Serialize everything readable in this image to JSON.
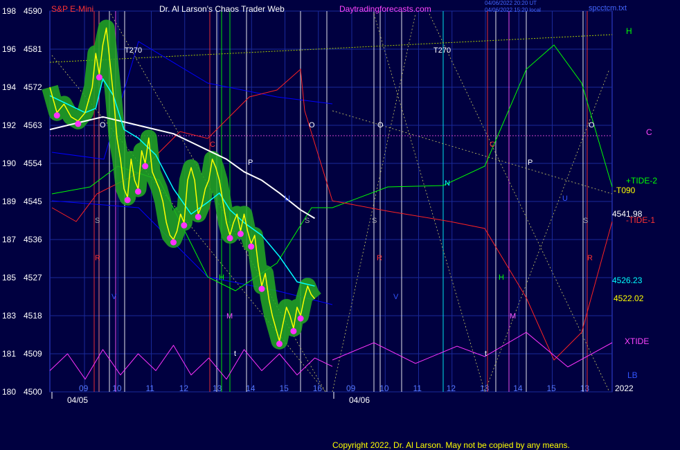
{
  "header": {
    "instrument": "S&P E-Mini",
    "title": "Dr. Al Larson's Chaos Trader Web",
    "site": "Daytradingforecasts.com",
    "stamp1": "04/06/2022 20:20 UT",
    "stamp2": "04/06/2022 15:20 local",
    "stamp3": "spcctcm.txt"
  },
  "copyright": "Copyright 2022, Dr. Al Larson. May not be copied by any means.",
  "colors": {
    "background": "#000040",
    "grid": "#1a2a9a",
    "price": "#ffff00",
    "avg_fast": "#00ffff",
    "avg_slow": "#ffffff",
    "band": "#22aa22",
    "xtide": "#ff33ff",
    "tide1": "#ff2222",
    "tide2": "#00ff00",
    "electric_field": "#0000ff"
  },
  "chart_data": {
    "type": "line",
    "title": "",
    "y_left_labels": [
      "198",
      "196",
      "194",
      "192",
      "190",
      "189",
      "187",
      "185",
      "183",
      "181",
      "180"
    ],
    "y_right_labels": [
      "4590",
      "4581",
      "4572",
      "4563",
      "4554",
      "4545",
      "4536",
      "4527",
      "4518",
      "4509",
      "4500"
    ],
    "y_range": [
      4500,
      4590
    ],
    "x_range_hours": [
      8.5,
      16.5
    ],
    "x_hour_labels": [
      "09",
      "10",
      "11",
      "12",
      "13",
      "14",
      "15",
      "16",
      "09",
      "10",
      "11",
      "12",
      "13",
      "14",
      "15",
      "13"
    ],
    "x_date_labels": [
      "04/05",
      "04/06"
    ],
    "year_label": "2022",
    "right_side_labels": {
      "h": "H",
      "c": "C",
      "tide2": "+TIDE-2",
      "t090": "-T090",
      "price_last": "4541.98",
      "tide1": "-TIDE-1",
      "avg_last": "4526.23",
      "close_last": "4522.02",
      "xtide": "XTIDE",
      "lb": "LB"
    },
    "annotations": [
      "T270",
      "T270",
      "O",
      "O",
      "O",
      "O",
      "P",
      "P",
      "C",
      "C",
      "S",
      "S",
      "S",
      "S",
      "R",
      "R",
      "R",
      "H",
      "H",
      "M",
      "M",
      "N",
      "U",
      "U",
      "V",
      "V",
      "t",
      "t"
    ],
    "price_series": {
      "name": "",
      "x": [
        8.5,
        8.7,
        8.9,
        9.1,
        9.3,
        9.5,
        9.7,
        9.8,
        9.9,
        10.0,
        10.1,
        10.2,
        10.3,
        10.4,
        10.5,
        10.6,
        10.7,
        10.8,
        10.9,
        11.0,
        11.1,
        11.2,
        11.3,
        11.4,
        11.5,
        11.6,
        11.7,
        11.8,
        11.9,
        12.0,
        12.1,
        12.2,
        12.3,
        12.4,
        12.5,
        12.6,
        12.7,
        12.8,
        12.9,
        13.0,
        13.1,
        13.2,
        13.3,
        13.4,
        13.5,
        13.6,
        13.7,
        13.8,
        13.9,
        14.0,
        14.1,
        14.2,
        14.3,
        14.4,
        14.5,
        14.6,
        14.7,
        14.8,
        14.9,
        15.0,
        15.1,
        15.2,
        15.3,
        15.4,
        15.5,
        15.6,
        15.7,
        15.8,
        15.9,
        16.0
      ],
      "y": [
        4572,
        4566,
        4568,
        4565,
        4564,
        4566,
        4572,
        4580,
        4575,
        4582,
        4586,
        4578,
        4570,
        4560,
        4555,
        4548,
        4546,
        4555,
        4550,
        4548,
        4557,
        4554,
        4560,
        4552,
        4550,
        4548,
        4545,
        4540,
        4537,
        4536,
        4538,
        4542,
        4540,
        4550,
        4553,
        4550,
        4542,
        4544,
        4548,
        4550,
        4555,
        4553,
        4550,
        4545,
        4540,
        4537,
        4540,
        4542,
        4538,
        4542,
        4538,
        4535,
        4537,
        4530,
        4525,
        4528,
        4522,
        4518,
        4515,
        4512,
        4516,
        4520,
        4518,
        4515,
        4520,
        4518,
        4522,
        4525,
        4523,
        4522
      ]
    },
    "avg_fast": {
      "name": "",
      "x": [
        8.5,
        9.0,
        9.5,
        9.8,
        10.0,
        10.3,
        10.6,
        11.0,
        11.5,
        12.0,
        12.5,
        13.0,
        13.3,
        13.6,
        14.0,
        14.5,
        15.0,
        15.5,
        16.0
      ],
      "y": [
        4570,
        4568,
        4566,
        4567,
        4574,
        4570,
        4562,
        4560,
        4556,
        4548,
        4542,
        4545,
        4547,
        4543,
        4540,
        4537,
        4532,
        4526,
        4525
      ]
    },
    "avg_slow": {
      "name": "",
      "x": [
        8.5,
        9.0,
        9.5,
        10.0,
        10.5,
        11.0,
        11.5,
        12.0,
        12.5,
        13.0,
        13.5,
        14.0,
        14.5,
        15.0,
        15.3,
        15.6,
        16.0
      ],
      "y": [
        4562,
        4563,
        4564,
        4565,
        4564,
        4563,
        4562,
        4561,
        4559,
        4557,
        4555,
        4552,
        4550,
        4547,
        4545,
        4543,
        4541
      ]
    },
    "xtide": {
      "name": "XTIDE",
      "x": [
        8.5,
        9.0,
        9.5,
        10.0,
        10.5,
        11.0,
        11.5,
        12.0,
        12.5,
        13.0,
        13.5,
        14.0,
        14.5,
        15.0,
        15.5,
        16.0,
        16.5
      ],
      "y": [
        4505,
        4509,
        4503,
        4510,
        4504,
        4509,
        4505,
        4511,
        4504,
        4508,
        4503,
        4510,
        4505,
        4509,
        4504,
        4508,
        4506
      ]
    }
  }
}
